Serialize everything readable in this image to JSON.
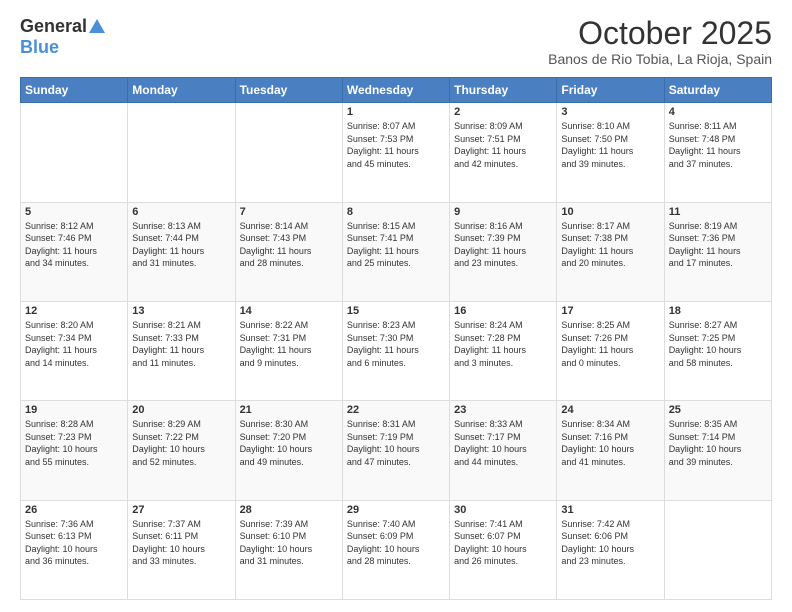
{
  "header": {
    "logo_general": "General",
    "logo_blue": "Blue",
    "month_title": "October 2025",
    "location": "Banos de Rio Tobia, La Rioja, Spain"
  },
  "days_of_week": [
    "Sunday",
    "Monday",
    "Tuesday",
    "Wednesday",
    "Thursday",
    "Friday",
    "Saturday"
  ],
  "weeks": [
    [
      {
        "day": "",
        "info": ""
      },
      {
        "day": "",
        "info": ""
      },
      {
        "day": "",
        "info": ""
      },
      {
        "day": "1",
        "info": "Sunrise: 8:07 AM\nSunset: 7:53 PM\nDaylight: 11 hours\nand 45 minutes."
      },
      {
        "day": "2",
        "info": "Sunrise: 8:09 AM\nSunset: 7:51 PM\nDaylight: 11 hours\nand 42 minutes."
      },
      {
        "day": "3",
        "info": "Sunrise: 8:10 AM\nSunset: 7:50 PM\nDaylight: 11 hours\nand 39 minutes."
      },
      {
        "day": "4",
        "info": "Sunrise: 8:11 AM\nSunset: 7:48 PM\nDaylight: 11 hours\nand 37 minutes."
      }
    ],
    [
      {
        "day": "5",
        "info": "Sunrise: 8:12 AM\nSunset: 7:46 PM\nDaylight: 11 hours\nand 34 minutes."
      },
      {
        "day": "6",
        "info": "Sunrise: 8:13 AM\nSunset: 7:44 PM\nDaylight: 11 hours\nand 31 minutes."
      },
      {
        "day": "7",
        "info": "Sunrise: 8:14 AM\nSunset: 7:43 PM\nDaylight: 11 hours\nand 28 minutes."
      },
      {
        "day": "8",
        "info": "Sunrise: 8:15 AM\nSunset: 7:41 PM\nDaylight: 11 hours\nand 25 minutes."
      },
      {
        "day": "9",
        "info": "Sunrise: 8:16 AM\nSunset: 7:39 PM\nDaylight: 11 hours\nand 23 minutes."
      },
      {
        "day": "10",
        "info": "Sunrise: 8:17 AM\nSunset: 7:38 PM\nDaylight: 11 hours\nand 20 minutes."
      },
      {
        "day": "11",
        "info": "Sunrise: 8:19 AM\nSunset: 7:36 PM\nDaylight: 11 hours\nand 17 minutes."
      }
    ],
    [
      {
        "day": "12",
        "info": "Sunrise: 8:20 AM\nSunset: 7:34 PM\nDaylight: 11 hours\nand 14 minutes."
      },
      {
        "day": "13",
        "info": "Sunrise: 8:21 AM\nSunset: 7:33 PM\nDaylight: 11 hours\nand 11 minutes."
      },
      {
        "day": "14",
        "info": "Sunrise: 8:22 AM\nSunset: 7:31 PM\nDaylight: 11 hours\nand 9 minutes."
      },
      {
        "day": "15",
        "info": "Sunrise: 8:23 AM\nSunset: 7:30 PM\nDaylight: 11 hours\nand 6 minutes."
      },
      {
        "day": "16",
        "info": "Sunrise: 8:24 AM\nSunset: 7:28 PM\nDaylight: 11 hours\nand 3 minutes."
      },
      {
        "day": "17",
        "info": "Sunrise: 8:25 AM\nSunset: 7:26 PM\nDaylight: 11 hours\nand 0 minutes."
      },
      {
        "day": "18",
        "info": "Sunrise: 8:27 AM\nSunset: 7:25 PM\nDaylight: 10 hours\nand 58 minutes."
      }
    ],
    [
      {
        "day": "19",
        "info": "Sunrise: 8:28 AM\nSunset: 7:23 PM\nDaylight: 10 hours\nand 55 minutes."
      },
      {
        "day": "20",
        "info": "Sunrise: 8:29 AM\nSunset: 7:22 PM\nDaylight: 10 hours\nand 52 minutes."
      },
      {
        "day": "21",
        "info": "Sunrise: 8:30 AM\nSunset: 7:20 PM\nDaylight: 10 hours\nand 49 minutes."
      },
      {
        "day": "22",
        "info": "Sunrise: 8:31 AM\nSunset: 7:19 PM\nDaylight: 10 hours\nand 47 minutes."
      },
      {
        "day": "23",
        "info": "Sunrise: 8:33 AM\nSunset: 7:17 PM\nDaylight: 10 hours\nand 44 minutes."
      },
      {
        "day": "24",
        "info": "Sunrise: 8:34 AM\nSunset: 7:16 PM\nDaylight: 10 hours\nand 41 minutes."
      },
      {
        "day": "25",
        "info": "Sunrise: 8:35 AM\nSunset: 7:14 PM\nDaylight: 10 hours\nand 39 minutes."
      }
    ],
    [
      {
        "day": "26",
        "info": "Sunrise: 7:36 AM\nSunset: 6:13 PM\nDaylight: 10 hours\nand 36 minutes."
      },
      {
        "day": "27",
        "info": "Sunrise: 7:37 AM\nSunset: 6:11 PM\nDaylight: 10 hours\nand 33 minutes."
      },
      {
        "day": "28",
        "info": "Sunrise: 7:39 AM\nSunset: 6:10 PM\nDaylight: 10 hours\nand 31 minutes."
      },
      {
        "day": "29",
        "info": "Sunrise: 7:40 AM\nSunset: 6:09 PM\nDaylight: 10 hours\nand 28 minutes."
      },
      {
        "day": "30",
        "info": "Sunrise: 7:41 AM\nSunset: 6:07 PM\nDaylight: 10 hours\nand 26 minutes."
      },
      {
        "day": "31",
        "info": "Sunrise: 7:42 AM\nSunset: 6:06 PM\nDaylight: 10 hours\nand 23 minutes."
      },
      {
        "day": "",
        "info": ""
      }
    ]
  ]
}
